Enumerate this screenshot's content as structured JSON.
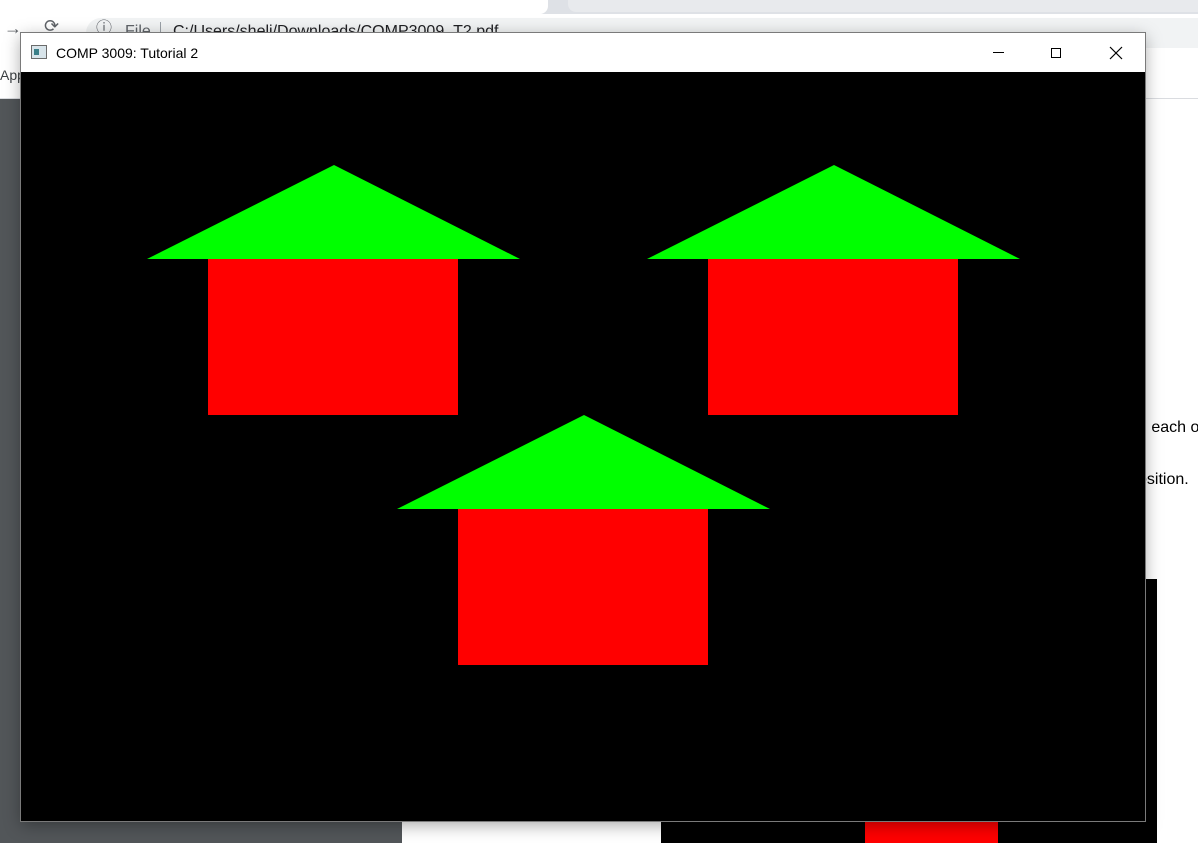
{
  "browser": {
    "url_scheme": "File",
    "url": "C:/Users/sheli/Downloads/COMP3009_T2.pdf",
    "bookmarks_label": "Apps"
  },
  "pdf": {
    "line1_fragment": "n each o",
    "line2_fragment": "osition."
  },
  "window": {
    "title": "COMP 3009: Tutorial 2",
    "controls": [
      "minimize",
      "maximize",
      "close"
    ]
  },
  "scene": {
    "background_color": "#000000",
    "roof_color": "#00ff00",
    "body_color": "#ff0000",
    "house_count": 3
  },
  "icons": {
    "back": "arrow-left-icon",
    "reload": "reload-icon",
    "info": "info-icon",
    "app": "app-icon",
    "minimize": "minimize-icon",
    "maximize": "maximize-icon",
    "close": "close-icon"
  }
}
